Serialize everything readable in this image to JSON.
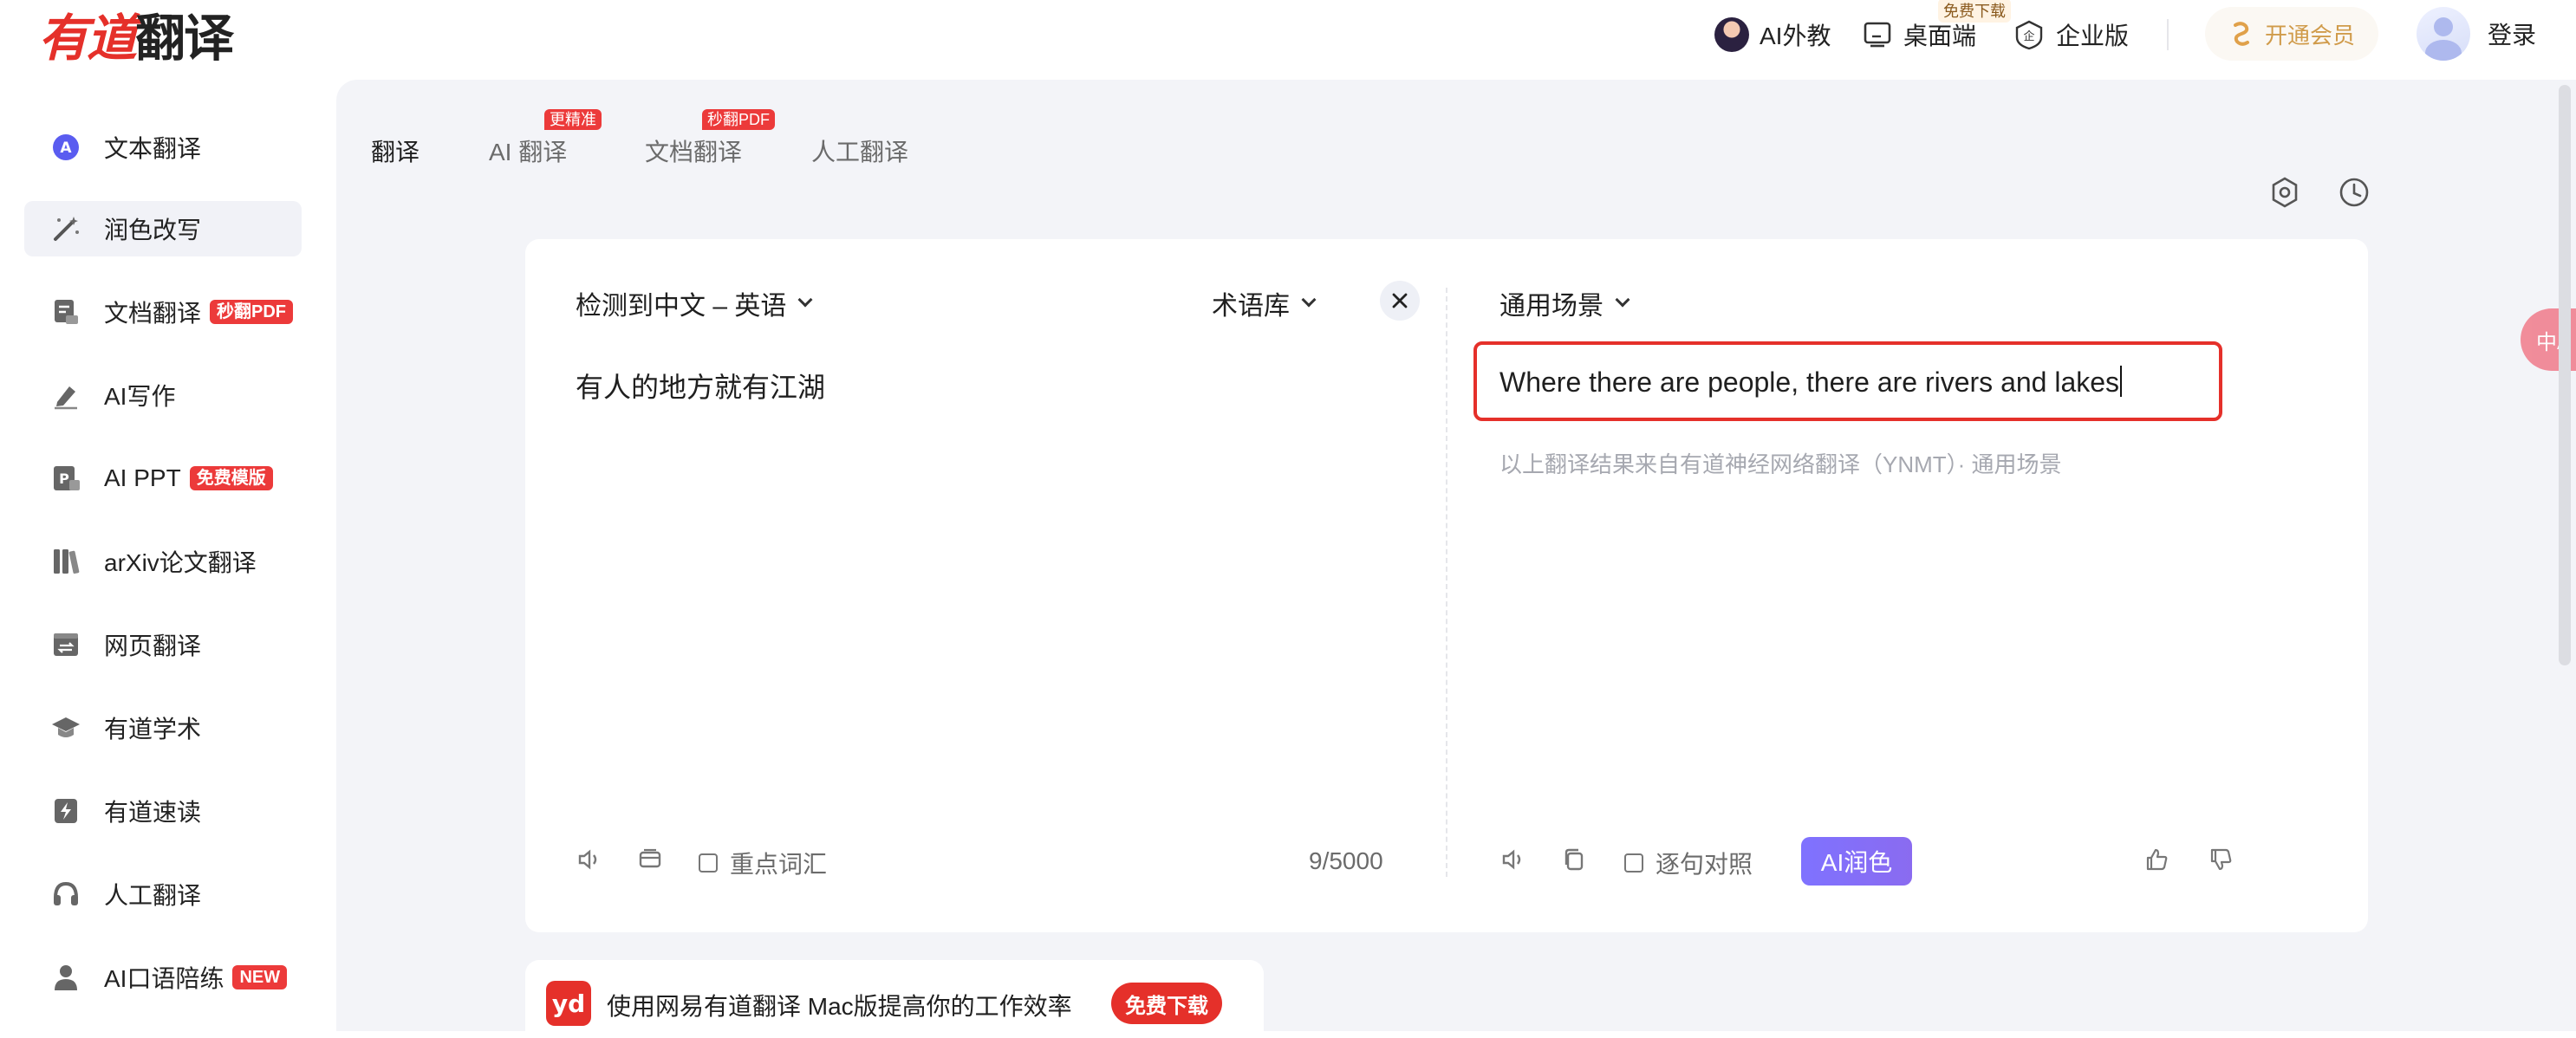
{
  "header": {
    "logo_red": "有道",
    "logo_black": "翻译",
    "ai_tutor": "AI外教",
    "desktop": "桌面端",
    "desktop_tag": "免费下载",
    "enterprise": "企业版",
    "vip": "开通会员",
    "login": "登录"
  },
  "sidebar": {
    "items": [
      {
        "label": "文本翻译",
        "icon": "translate-icon"
      },
      {
        "label": "润色改写",
        "icon": "magic-wand-icon"
      },
      {
        "label": "文档翻译",
        "icon": "document-icon",
        "badge": "秒翻PDF"
      },
      {
        "label": "AI写作",
        "icon": "pen-icon"
      },
      {
        "label": "AI PPT",
        "icon": "ppt-icon",
        "badge": "免费模版"
      },
      {
        "label": "arXiv论文翻译",
        "icon": "books-icon"
      },
      {
        "label": "网页翻译",
        "icon": "webpage-icon"
      },
      {
        "label": "有道学术",
        "icon": "academic-cap-icon"
      },
      {
        "label": "有道速读",
        "icon": "speed-read-icon"
      },
      {
        "label": "人工翻译",
        "icon": "headset-icon"
      },
      {
        "label": "AI口语陪练",
        "icon": "user-icon",
        "badge": "NEW"
      }
    ]
  },
  "tabs": [
    {
      "label": "翻译"
    },
    {
      "label": "AI 翻译",
      "badge": "更精准"
    },
    {
      "label": "文档翻译",
      "badge": "秒翻PDF"
    },
    {
      "label": "人工翻译"
    }
  ],
  "translator": {
    "lang_pair": "检测到中文 – 英语",
    "glossary": "术语库",
    "source_text": "有人的地方就有江湖",
    "scene": "通用场景",
    "result_text": "Where there are people, there are rivers and lakes",
    "source_note": "以上翻译结果来自有道神经网络翻译（YNMT）· 通用场景",
    "key_vocab": "重点词汇",
    "counter": "9/5000",
    "sentence_compare": "逐句对照",
    "ai_polish": "AI润色"
  },
  "promo": {
    "logo": "yd",
    "text": "使用网易有道翻译 Mac版提高你的工作效率",
    "download": "免费下载"
  },
  "float": {
    "label": "中A"
  },
  "colors": {
    "brand_red": "#e5302a",
    "accent_purple": "#7f72ff",
    "vip_gold": "#d09b4a"
  }
}
